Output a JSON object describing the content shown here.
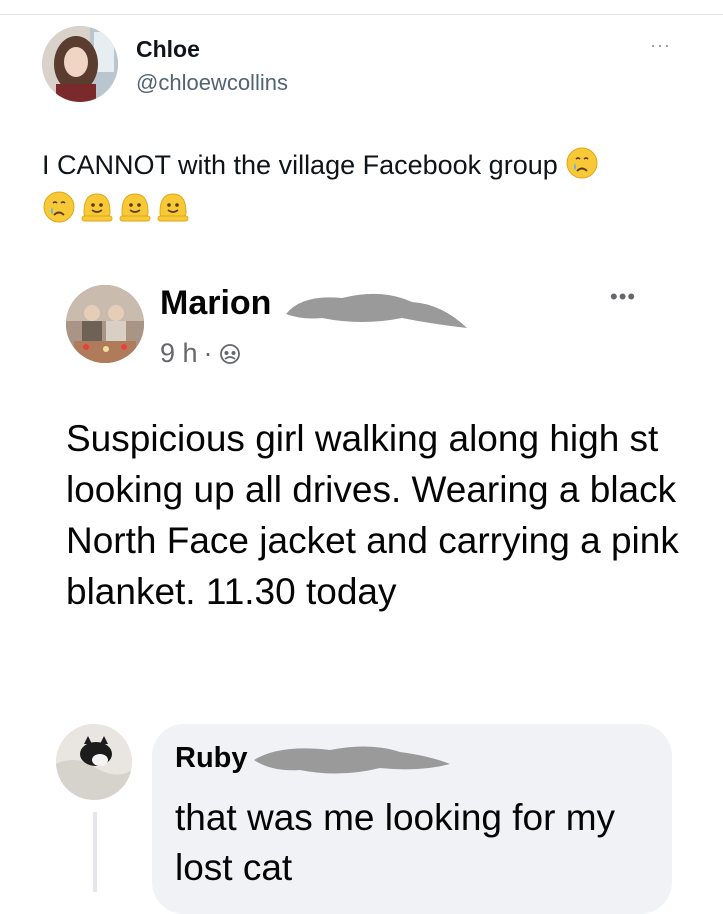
{
  "tweet": {
    "author_name": "Chloe",
    "author_handle": "@chloewcollins",
    "more_label": "···",
    "text": "I CANNOT with the village Facebook group",
    "emojis": [
      "crying-face",
      "melting-face",
      "melting-face",
      "melting-face"
    ]
  },
  "facebook_post": {
    "author_name": "Marion",
    "time": "9 h",
    "separator": "·",
    "audience_icon": "public-group-icon",
    "more_label": "•••",
    "text": "Suspicious girl walking along high st looking up all drives. Wearing a black North Face jacket and carrying a pink blanket. 11.30 today"
  },
  "comment": {
    "author_name": "Ruby",
    "text": "that was me looking for my lost cat"
  },
  "colors": {
    "text_primary": "#0f1419",
    "text_secondary": "#536471",
    "fb_meta": "#65676b",
    "bubble": "#f0f2f5",
    "redaction": "#9a9a9a"
  }
}
